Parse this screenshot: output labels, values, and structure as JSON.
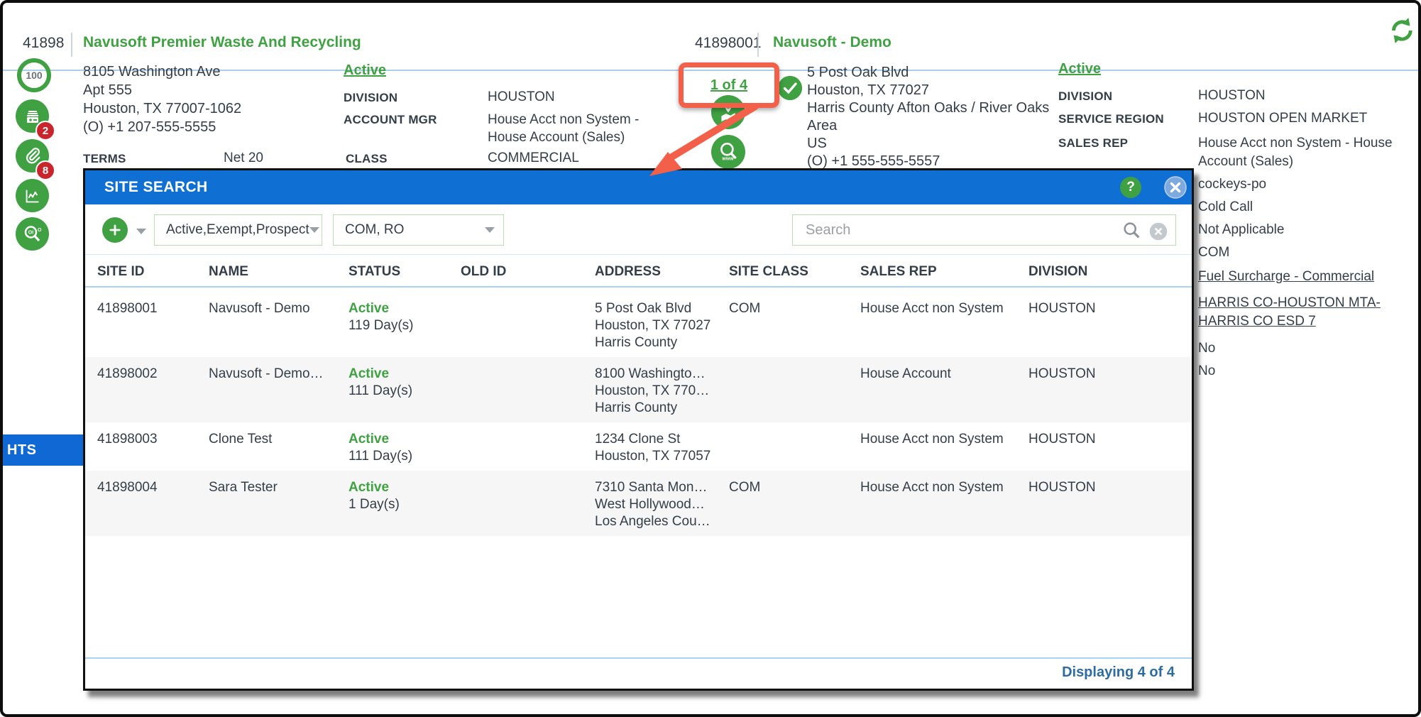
{
  "header": {
    "account_id": "41898",
    "account_name": "Navusoft Premier Waste And Recycling",
    "site_id": "41898001",
    "site_name": "Navusoft - Demo"
  },
  "sidebar": {
    "score": "100",
    "register_badge": "2",
    "attach_badge": "8"
  },
  "account": {
    "address1": "8105 Washington Ave",
    "address2": "Apt 555",
    "address3": "Houston, TX 77007-1062",
    "address4": "(O) +1 207-555-5555",
    "status": "Active",
    "division_label": "DIVISION",
    "division": "HOUSTON",
    "account_mgr_label": "ACCOUNT MGR",
    "account_mgr": "House Acct non System - House Account (Sales)",
    "terms_label": "TERMS",
    "terms": "Net 20",
    "class_label": "CLASS",
    "class": "COMMERCIAL"
  },
  "site": {
    "pager": "1 of 4",
    "address1": "5 Post Oak Blvd",
    "address2": "Houston, TX 77027",
    "address3": "Harris County Afton Oaks / River Oaks Area",
    "address4": "US",
    "address5": "(O) +1 555-555-5557",
    "status": "Active",
    "division_label": "DIVISION",
    "division": "HOUSTON",
    "service_region_label": "SERVICE REGION",
    "service_region": "HOUSTON OPEN MARKET",
    "sales_rep_label": "SALES REP",
    "sales_rep": "House Acct non System - House Account (Sales)",
    "extra1": "cockeys-po",
    "extra2": "Cold Call",
    "extra3": "Not Applicable",
    "extra4": "COM",
    "link1": "Fuel Surcharge - Commercial",
    "link2": "HARRIS CO-HOUSTON MTA-HARRIS CO ESD 7",
    "flag1": "No",
    "flag2": "No"
  },
  "highlights_tab": "HTS",
  "modal": {
    "title": "SITE SEARCH",
    "help_glyph": "?",
    "status_filter": "Active,Exempt,Prospect",
    "class_filter": "COM, RO",
    "search_placeholder": "Search",
    "columns": {
      "site_id": "SITE ID",
      "name": "NAME",
      "status": "STATUS",
      "old_id": "OLD ID",
      "address": "ADDRESS",
      "site_class": "SITE CLASS",
      "sales_rep": "SALES REP",
      "division": "DIVISION"
    },
    "rows": [
      {
        "site_id": "41898001",
        "name": "Navusoft - Demo",
        "status": "Active",
        "days": "119 Day(s)",
        "old_id": "",
        "addr1": "5 Post Oak Blvd",
        "addr2": "Houston, TX 77027",
        "addr3": "Harris County",
        "site_class": "COM",
        "sales_rep": "House Acct non System",
        "division": "HOUSTON"
      },
      {
        "site_id": "41898002",
        "name": "Navusoft - Demo…",
        "status": "Active",
        "days": "111 Day(s)",
        "old_id": "",
        "addr1": "8100 Washingto…",
        "addr2": "Houston, TX 770…",
        "addr3": "Harris County",
        "site_class": "",
        "sales_rep": "House Account",
        "division": "HOUSTON"
      },
      {
        "site_id": "41898003",
        "name": "Clone Test",
        "status": "Active",
        "days": "111 Day(s)",
        "old_id": "",
        "addr1": "1234 Clone St",
        "addr2": "Houston, TX 77057",
        "addr3": "",
        "site_class": "",
        "sales_rep": "House Acct non System",
        "division": "HOUSTON"
      },
      {
        "site_id": "41898004",
        "name": "Sara Tester",
        "status": "Active",
        "days": "1 Day(s)",
        "old_id": "",
        "addr1": "7310 Santa Mon…",
        "addr2": "West Hollywood…",
        "addr3": "Los Angeles Cou…",
        "site_class": "COM",
        "sales_rep": "House Acct non System",
        "division": "HOUSTON"
      }
    ],
    "footer": "Displaying 4 of 4"
  },
  "colors": {
    "brand_green": "#3fa142",
    "titlebar_blue": "#0f6fd2",
    "tab_blue": "#1068d4",
    "dark_text": "#333e48",
    "annotation_red": "#f2604a",
    "badge_red": "#c9252c",
    "divider_blue": "#aecde8",
    "alt_row": "#f6f6f6",
    "footer_blue": "#2d6ca2"
  }
}
